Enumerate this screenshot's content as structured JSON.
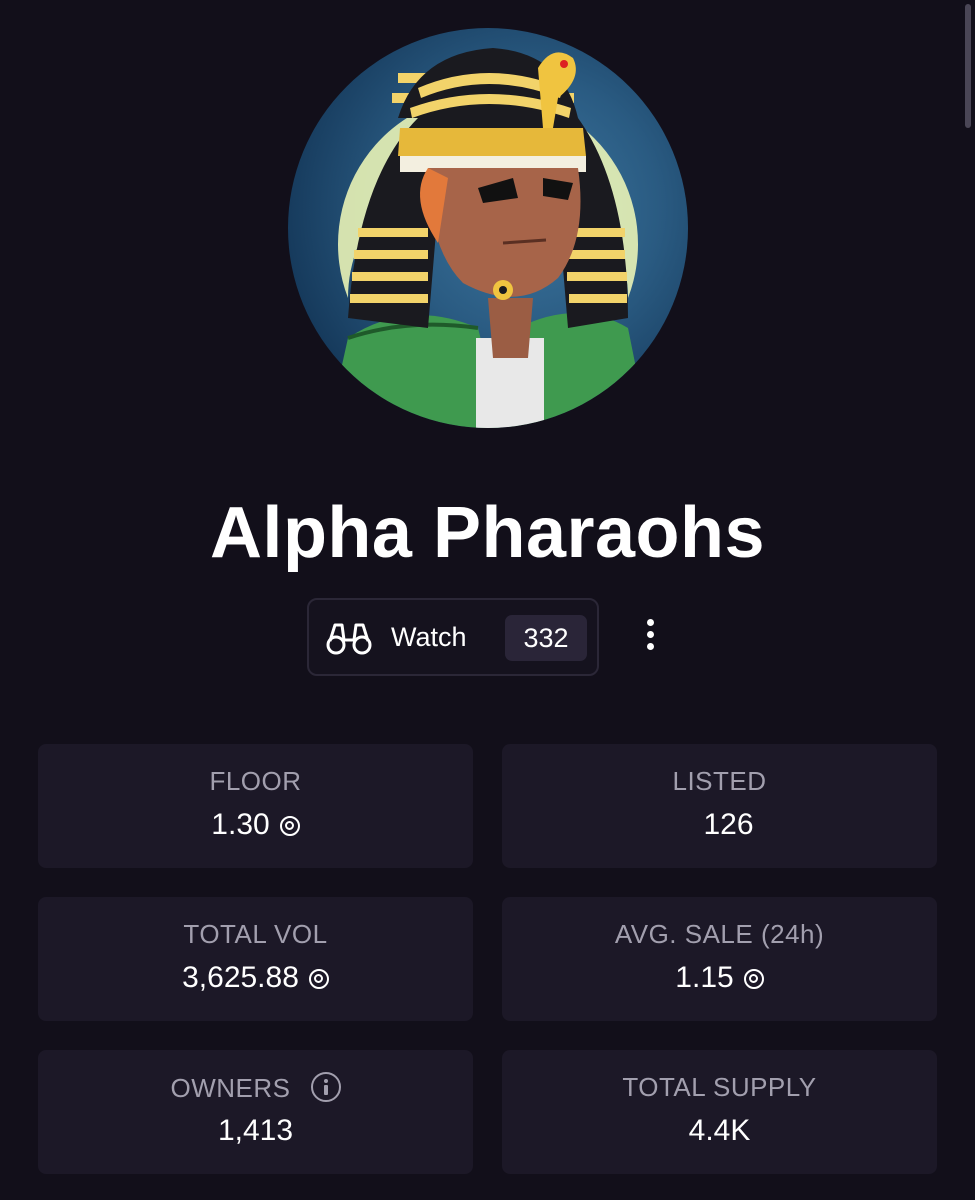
{
  "collection": {
    "name": "Alpha Pharaohs",
    "avatar_alt": "pharaoh-avatar"
  },
  "actions": {
    "watch_label": "Watch",
    "watch_count": "332",
    "watch_icon": "binoculars-icon",
    "more_icon": "vertical-dots-icon"
  },
  "stats": {
    "floor": {
      "label": "FLOOR",
      "value": "1.30"
    },
    "listed": {
      "label": "LISTED",
      "value": "126"
    },
    "total_vol": {
      "label": "TOTAL VOL",
      "value": "3,625.88"
    },
    "avg_sale": {
      "label": "AVG. SALE (24h)",
      "value": "1.15"
    },
    "owners": {
      "label": "OWNERS",
      "value": "1,413"
    },
    "total_supply": {
      "label": "TOTAL SUPPLY",
      "value": "4.4K"
    }
  },
  "colors": {
    "background": "#120f1a",
    "card": "#1c1827",
    "label": "#a29fae",
    "text": "#ffffff"
  }
}
